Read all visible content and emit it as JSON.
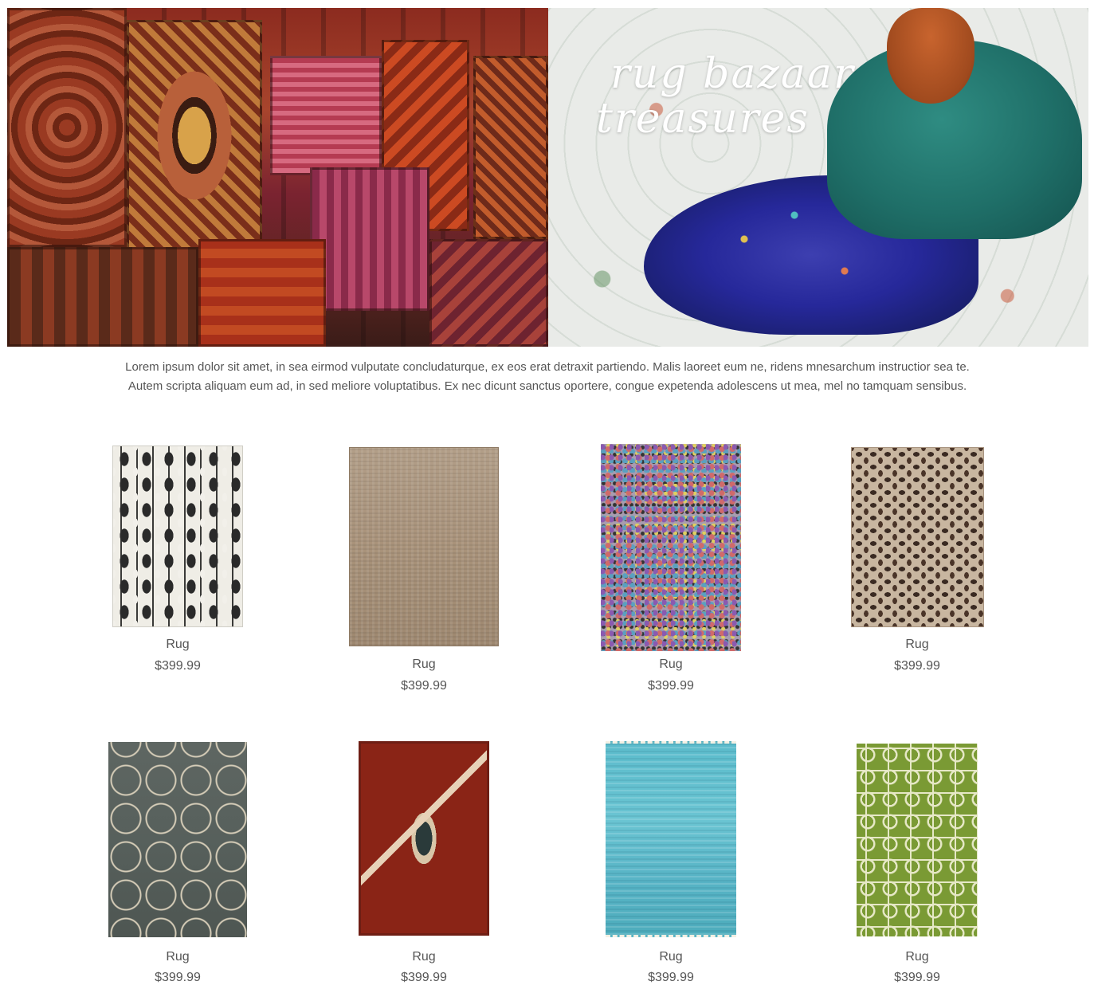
{
  "hero": {
    "script_line1": "rug bazaar",
    "script_line2": "treasures"
  },
  "intro": {
    "text": "Lorem ipsum dolor sit amet, in sea eirmod vulputate concludaturque, ex eos erat detraxit partiendo. Malis laoreet eum ne, ridens mnesarchum instructior sea te. Autem scripta aliquam eum ad, in sed meliore voluptatibus. Ex nec dicunt sanctus oportere, congue expetenda adolescens ut mea, mel no tamquam sensibus."
  },
  "products": [
    {
      "name": "Rug",
      "price": "$399.99",
      "image": "ikat-black-white-rug"
    },
    {
      "name": "Rug",
      "price": "$399.99",
      "image": "natural-jute-rug"
    },
    {
      "name": "Rug",
      "price": "$399.99",
      "image": "multicolor-shag-rug"
    },
    {
      "name": "Rug",
      "price": "$399.99",
      "image": "leopard-print-rug"
    },
    {
      "name": "Rug",
      "price": "$399.99",
      "image": "grey-trellis-rug"
    },
    {
      "name": "Rug",
      "price": "$399.99",
      "image": "red-kilim-rug"
    },
    {
      "name": "Rug",
      "price": "$399.99",
      "image": "aqua-sari-silk-rug"
    },
    {
      "name": "Rug",
      "price": "$399.99",
      "image": "green-geometric-rug"
    }
  ]
}
